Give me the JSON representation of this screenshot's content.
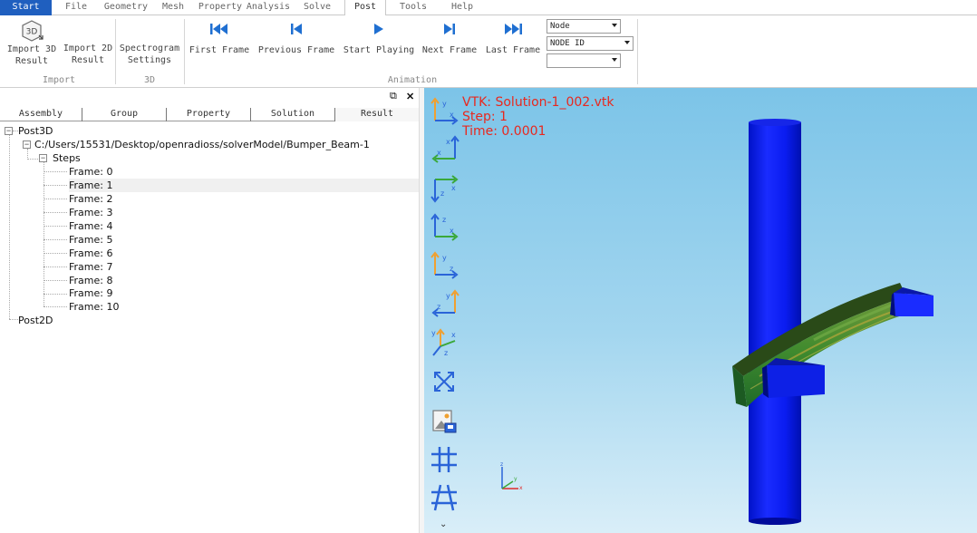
{
  "menu": {
    "items": [
      "Start",
      "File",
      "Geometry",
      "Mesh",
      "Property",
      "Analysis",
      "Solve",
      "Post",
      "Tools",
      "Help"
    ],
    "active": "Post"
  },
  "ribbon": {
    "import_group": {
      "label": "Import",
      "import3d_line1": "Import 3D",
      "import3d_line2": "Result",
      "import2d_line1": "Import 2D",
      "import2d_line2": "Result"
    },
    "group_3d": {
      "label": "3D",
      "spectrogram_line1": "Spectrogram",
      "spectrogram_line2": "Settings"
    },
    "animation_group": {
      "label": "Animation",
      "first_frame": "First Frame",
      "previous_frame": "Previous Frame",
      "start_playing": "Start Playing",
      "next_frame": "Next Frame",
      "last_frame": "Last Frame"
    },
    "combos": {
      "type_value": "Node",
      "id_value": "NODE ID",
      "third_value": ""
    },
    "icon_3d_text": "3D"
  },
  "panel": {
    "tabs": [
      "Assembly",
      "Group",
      "Property",
      "Solution",
      "Result"
    ],
    "active_tab": "Result",
    "float_icon": "⧉",
    "close_icon": "✕",
    "tree": {
      "root": "Post3D",
      "path": "C:/Users/15531/Desktop/openradioss/solverModel/Bumper_Beam-1",
      "steps": "Steps",
      "frames": [
        "Frame: 0",
        "Frame: 1",
        "Frame: 2",
        "Frame: 3",
        "Frame: 4",
        "Frame: 5",
        "Frame: 6",
        "Frame: 7",
        "Frame: 8",
        "Frame: 9",
        "Frame: 10"
      ],
      "selected_frame": "Frame: 1",
      "root2": "Post2D"
    }
  },
  "viewport": {
    "file_line": "VTK: Solution-1_002.vtk",
    "step_line": "Step: 1",
    "time_line": "Time:  0.0001",
    "overlay_text_color": "#e8281e",
    "pole_color": "#0a1cf0",
    "beam_color": "#2d7a2a",
    "toolbar_icons": [
      "view-xy-icon",
      "view-x-neg-y-icon",
      "view-xz-icon",
      "view-zx-icon",
      "view-zy-icon",
      "view-yz-icon",
      "isometric-view-icon",
      "fit-view-icon",
      "screenshot-icon",
      "mesh-grid-icon",
      "section-grid-icon"
    ],
    "more_glyph": "⌄",
    "axis_labels": {
      "x": "x",
      "y": "y",
      "z": "z"
    }
  },
  "colors": {
    "menu_start_bg": "#1f5fbf",
    "play_blue": "#1f6fd1",
    "axis_orange": "#f0a030",
    "axis_green": "#3aa83a",
    "axis_blue": "#2a64d8"
  }
}
